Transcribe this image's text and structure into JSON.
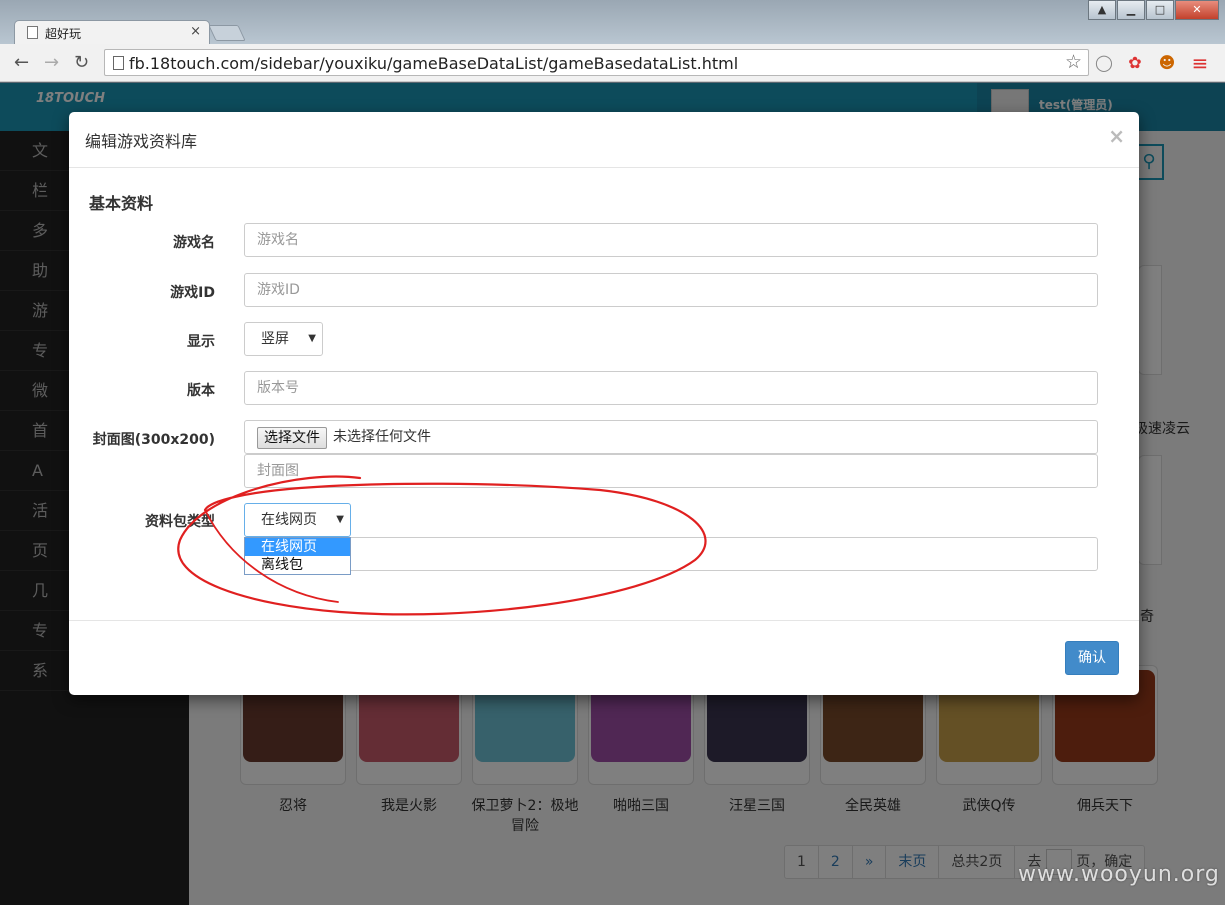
{
  "browser": {
    "tab_title": "超好玩",
    "tab_close": "×",
    "url": "fb.18touch.com/sidebar/youxiku/gameBaseDataList/gameBasedataList.html"
  },
  "app": {
    "logo": "18TOUCH",
    "user": "test(管理员)"
  },
  "sidebar": {
    "items": [
      "文",
      "栏",
      "多",
      "助",
      "游",
      "专",
      "微",
      "首",
      "A",
      "活",
      "页",
      "几",
      "专",
      "系"
    ]
  },
  "games": {
    "names": [
      "忍将",
      "我是火影",
      "保卫萝卜2：极地冒险",
      "啪啪三国",
      "汪星三国",
      "全民英雄",
      "武侠Q传",
      "佣兵天下"
    ],
    "thumb_colors": [
      "#6b3a2e",
      "#c95a6a",
      "#6fc3d6",
      "#a04fa8",
      "#3a3550",
      "#7a4a2a",
      "#c9a04a",
      "#9a3a1a"
    ],
    "right_labels": [
      "极速凌云",
      "奇"
    ]
  },
  "pager": {
    "p1": "1",
    "p2": "2",
    "next": "»",
    "last": "末页",
    "total": "总共2页",
    "go_prefix": "去",
    "go_suffix": "页，确定"
  },
  "modal": {
    "title": "编辑游戏资料库",
    "close": "×",
    "section": "基本资料",
    "fields": {
      "game_name_label": "游戏名",
      "game_name_placeholder": "游戏名",
      "game_id_label": "游戏ID",
      "game_id_placeholder": "游戏ID",
      "display_label": "显示",
      "display_value": "竖屏",
      "version_label": "版本",
      "version_placeholder": "版本号",
      "cover_label": "封面图(300x200)",
      "file_button": "选择文件",
      "file_status": "未选择任何文件",
      "cover_placeholder": "封面图",
      "package_label": "资料包类型",
      "package_value": "在线网页",
      "package_options": [
        "在线网页",
        "离线包"
      ]
    },
    "confirm": "确认"
  },
  "watermark": "www.wooyun.org"
}
